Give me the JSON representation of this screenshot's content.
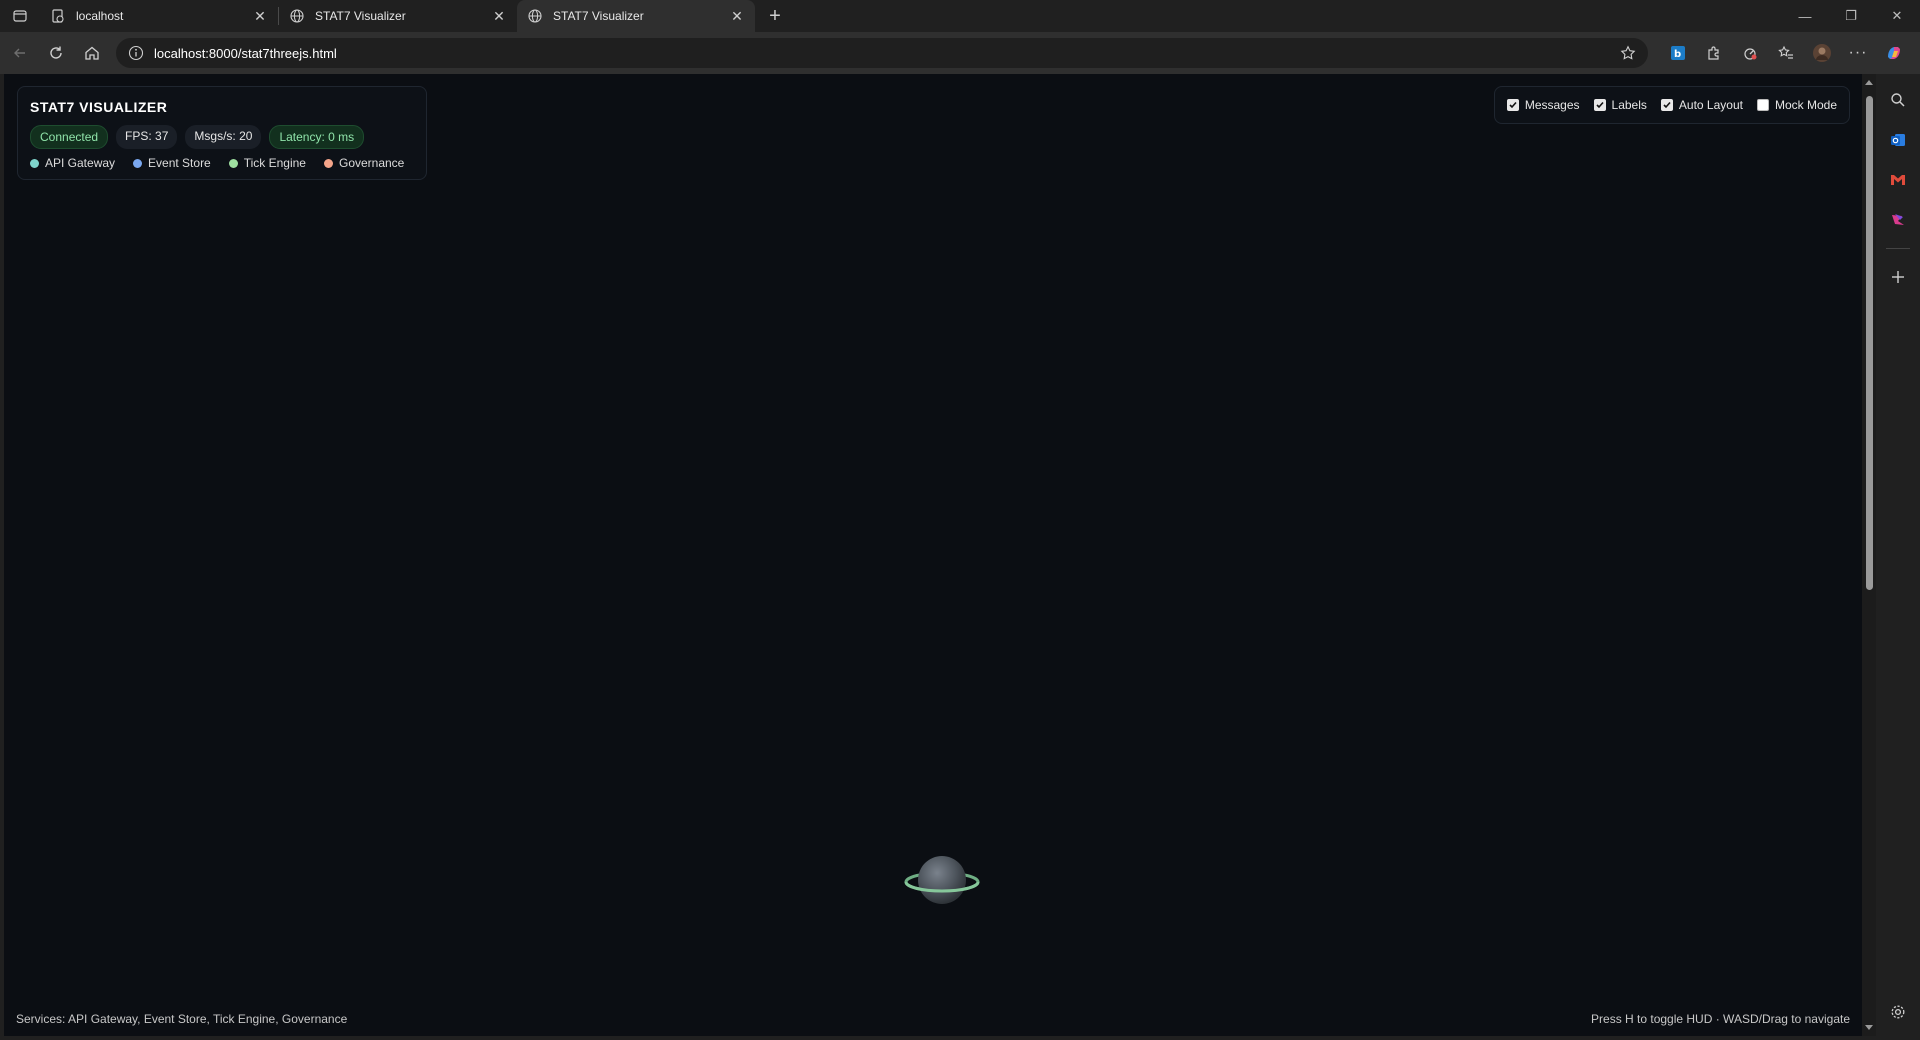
{
  "browser": {
    "tabs": [
      {
        "title": "localhost",
        "active": false
      },
      {
        "title": "STAT7 Visualizer",
        "active": false
      },
      {
        "title": "STAT7 Visualizer",
        "active": true
      }
    ],
    "new_tab_label": "+",
    "url": "localhost:8000/stat7threejs.html"
  },
  "hud": {
    "title": "STAT7 VISUALIZER",
    "status": "Connected",
    "fps": "FPS: 37",
    "msgs": "Msgs/s: 20",
    "latency": "Latency: 0 ms",
    "legend": [
      {
        "label": "API Gateway",
        "color": "#7fd4cc"
      },
      {
        "label": "Event Store",
        "color": "#7aa8f0"
      },
      {
        "label": "Tick Engine",
        "color": "#9ee0a0"
      },
      {
        "label": "Governance",
        "color": "#f4a58a"
      }
    ]
  },
  "controls": [
    {
      "label": "Messages",
      "checked": true
    },
    {
      "label": "Labels",
      "checked": true
    },
    {
      "label": "Auto Layout",
      "checked": true
    },
    {
      "label": "Mock Mode",
      "checked": false
    }
  ],
  "footer": {
    "left": "Services: API Gateway, Event Store, Tick Engine, Governance",
    "right": "Press H to toggle HUD · WASD/Drag to navigate"
  },
  "colors": {
    "page_bg": "#0b0e13",
    "connected": "#8fe3a9",
    "planet_ring": "#7fbf8f"
  }
}
